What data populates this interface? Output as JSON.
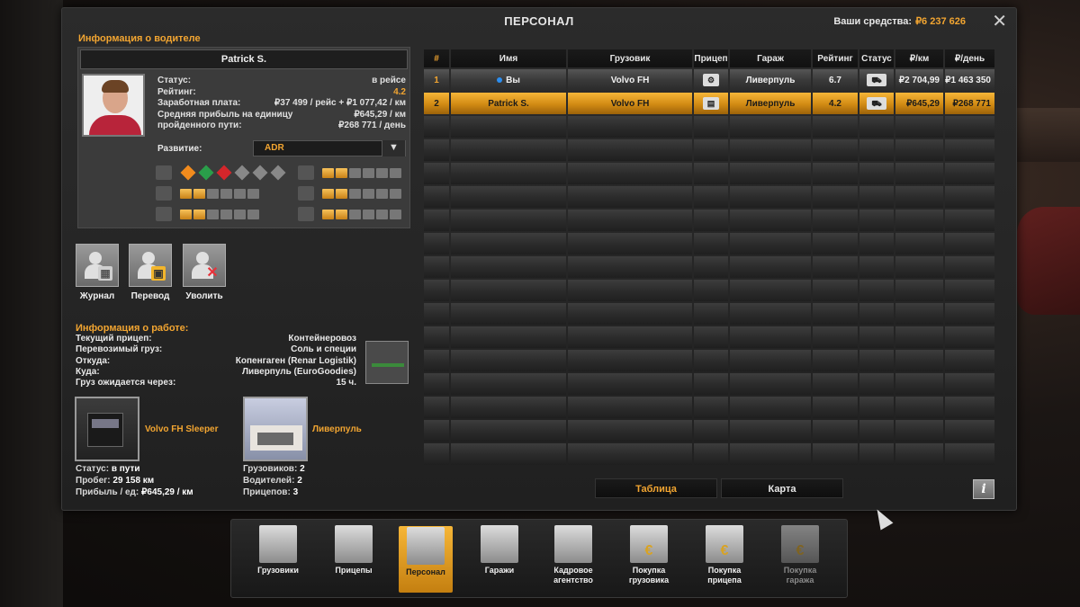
{
  "window": {
    "title": "ПЕРСОНАЛ",
    "funds_label": "Ваши средства:",
    "funds_value": "₽6 237 626",
    "close_icon": "✕"
  },
  "driver": {
    "section_title": "Информация о водителе",
    "name": "Patrick S.",
    "fields": [
      {
        "k": "Статус:",
        "v": "в рейсе",
        "orange": false
      },
      {
        "k": "Рейтинг:",
        "v": "4.2",
        "orange": true
      },
      {
        "k": "Заработная плата:",
        "v": "₽37 499 / рейс + ₽1 077,42 / км",
        "orange": false
      },
      {
        "k": "Средняя прибыль на единицу",
        "v": "₽645,29 / км",
        "orange": false
      },
      {
        "k": "пройденного пути:",
        "v": "₽268 771 / день",
        "orange": false
      }
    ],
    "development_label": "Развитие:",
    "development_value": "ADR",
    "skills_left": [
      {
        "icon": "adr-icon",
        "type": "adr",
        "levels": [
          "orange",
          "green",
          "red",
          "grey",
          "grey",
          "grey"
        ]
      },
      {
        "icon": "distance-icon",
        "type": "bar",
        "filled": 2,
        "total": 6
      },
      {
        "icon": "high-value-icon",
        "type": "bar",
        "filled": 2,
        "total": 6
      }
    ],
    "skills_right": [
      {
        "icon": "fragile-icon",
        "type": "bar",
        "filled": 2,
        "total": 6
      },
      {
        "icon": "urgent-icon",
        "type": "bar",
        "filled": 2,
        "total": 6
      },
      {
        "icon": "eco-icon",
        "type": "bar",
        "filled": 2,
        "total": 6
      }
    ]
  },
  "actions": {
    "journal": "Журнал",
    "transfer": "Перевод",
    "fire": "Уволить"
  },
  "job": {
    "section_title": "Информация о работе:",
    "fields": [
      {
        "k": "Текущий прицеп:",
        "v": "Контейнеровоз"
      },
      {
        "k": "Перевозимый груз:",
        "v": "Соль и специи"
      },
      {
        "k": "Откуда:",
        "v": "Копенгаген (Renar Logistik)"
      },
      {
        "k": "Куда:",
        "v": "Ливерпуль (EuroGoodies)"
      },
      {
        "k": "Груз ожидается через:",
        "v": "15 ч."
      }
    ],
    "truck_name": "Volvo FH Sleeper",
    "truck_stats": [
      {
        "k": "Статус:",
        "v": "в пути"
      },
      {
        "k": "Пробег:",
        "v": "29 158 км"
      },
      {
        "k": "Прибыль / ед:",
        "v": "₽645,29 / км"
      }
    ],
    "garage_name": "Ливерпуль",
    "garage_stats": [
      {
        "k": "Грузовиков:",
        "v": "2"
      },
      {
        "k": "Водителей:",
        "v": "2"
      },
      {
        "k": "Прицепов:",
        "v": "3"
      }
    ]
  },
  "table": {
    "headers": [
      "#",
      "Имя",
      "Грузовик",
      "Прицеп",
      "Гараж",
      "Рейтинг",
      "Статус",
      "₽/км",
      "₽/день"
    ],
    "rows": [
      {
        "idx": "1",
        "name": "Вы",
        "truck": "Volvo FH",
        "trailer_icon": "own-trailer-icon",
        "garage": "Ливерпуль",
        "rating": "6.7",
        "status_icon": "truck-status-icon",
        "per_km": "₽2 704,99",
        "per_day": "₽1 463 350",
        "self": true,
        "selected": false
      },
      {
        "idx": "2",
        "name": "Patrick S.",
        "truck": "Volvo FH",
        "trailer_icon": "container-trailer-icon",
        "garage": "Ливерпуль",
        "rating": "4.2",
        "status_icon": "truck-status-icon",
        "per_km": "₽645,29",
        "per_day": "₽268 771",
        "self": false,
        "selected": true
      }
    ],
    "empty_rows": 15
  },
  "tabs": {
    "table": "Таблица",
    "map": "Карта"
  },
  "info_icon": "i",
  "bottom_menu": [
    {
      "id": "trucks",
      "label": "Грузовики",
      "icon": "trucks-icon",
      "mark": "",
      "active": false,
      "disabled": false
    },
    {
      "id": "trailers",
      "label": "Прицепы",
      "icon": "trailers-icon",
      "mark": "",
      "active": false,
      "disabled": false
    },
    {
      "id": "staff",
      "label": "Персонал",
      "icon": "staff-icon",
      "mark": "",
      "active": true,
      "disabled": false
    },
    {
      "id": "garages",
      "label": "Гаражи",
      "icon": "garages-icon",
      "mark": "",
      "active": false,
      "disabled": false
    },
    {
      "id": "agency",
      "label": "Кадровое агентство",
      "icon": "agency-icon",
      "mark": "",
      "active": false,
      "disabled": false
    },
    {
      "id": "buy-truck",
      "label": "Покупка грузовика",
      "icon": "buy-truck-icon",
      "mark": "€",
      "active": false,
      "disabled": false
    },
    {
      "id": "buy-trailer",
      "label": "Покупка прицепа",
      "icon": "buy-trailer-icon",
      "mark": "€",
      "active": false,
      "disabled": false
    },
    {
      "id": "buy-garage",
      "label": "Покупка гаража",
      "icon": "buy-garage-icon",
      "mark": "€",
      "active": false,
      "disabled": true
    }
  ]
}
